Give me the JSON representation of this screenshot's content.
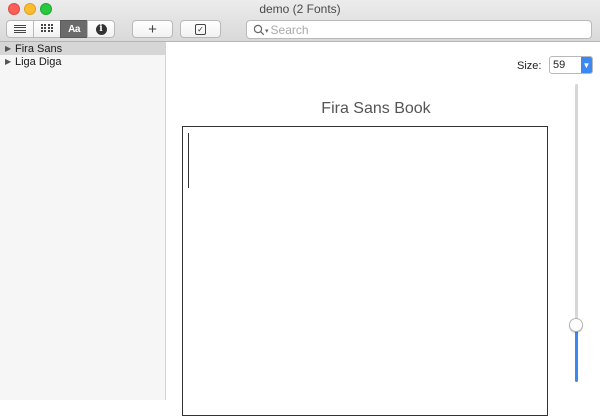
{
  "window": {
    "title": "demo (2 Fonts)"
  },
  "toolbar": {
    "view_buttons": [
      {
        "name": "list-view-button",
        "icon": "list-icon"
      },
      {
        "name": "grid-view-button",
        "icon": "grid-icon"
      },
      {
        "name": "sample-view-button",
        "icon": "sample-icon",
        "label": "Aa",
        "active": true
      },
      {
        "name": "info-view-button",
        "icon": "info-icon"
      }
    ],
    "search": {
      "placeholder": "Search",
      "value": ""
    }
  },
  "sidebar": {
    "items": [
      {
        "label": "Fira Sans",
        "selected": true
      },
      {
        "label": "Liga Diga",
        "selected": false
      }
    ]
  },
  "preview": {
    "size_label": "Size:",
    "size_value": "59",
    "font_title": "Fira Sans Book",
    "slider_fraction": 0.19
  },
  "colors": {
    "accent": "#3b87f3",
    "selected_row": "#d6d6d6"
  }
}
